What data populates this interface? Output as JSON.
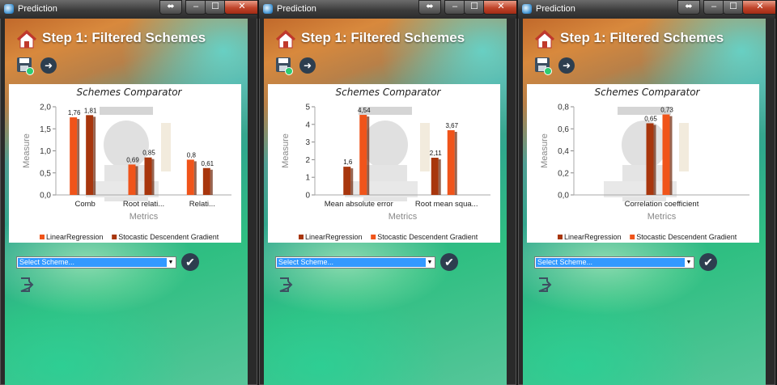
{
  "windows": [
    {
      "title": "Prediction",
      "step_title": "Step 1: Filtered Schemes",
      "combo_value": "Select Scheme...",
      "chart_data": {
        "type": "bar",
        "title": "Schemes Comparator",
        "xlabel": "Metrics",
        "ylabel": "Measure",
        "ylim": [
          0,
          2.0
        ],
        "yticks": [
          "0,0",
          "0,5",
          "1,0",
          "1,5",
          "2,0"
        ],
        "categories": [
          "Comb",
          "Root relati...",
          "Relati..."
        ],
        "series": [
          {
            "name": "LinearRegression",
            "values": [
              1.76,
              0.69,
              0.8
            ],
            "labels": [
              "1,76",
              "0,69",
              "0,8"
            ],
            "color": "#f0541a"
          },
          {
            "name": "Stocastic Descendent Gradient",
            "values": [
              1.81,
              0.85,
              0.61
            ],
            "labels": [
              "1,81",
              "0,85",
              "0,61"
            ],
            "color": "#a8360d"
          }
        ],
        "legend": "bottom"
      }
    },
    {
      "title": "Prediction",
      "step_title": "Step 1: Filtered Schemes",
      "combo_value": "Select Scheme...",
      "chart_data": {
        "type": "bar",
        "title": "Schemes Comparator",
        "xlabel": "Metrics",
        "ylabel": "Measure",
        "ylim": [
          0,
          5
        ],
        "yticks": [
          "0",
          "1",
          "2",
          "3",
          "4",
          "5"
        ],
        "categories": [
          "Mean absolute error",
          "Root mean squa..."
        ],
        "series": [
          {
            "name": "LinearRegression",
            "values": [
              1.6,
              2.11
            ],
            "labels": [
              "1,6",
              "2,11"
            ],
            "color": "#a8360d"
          },
          {
            "name": "Stocastic Descendent Gradient",
            "values": [
              4.54,
              3.67
            ],
            "labels": [
              "4,54",
              "3,67"
            ],
            "color": "#f0541a"
          }
        ],
        "legend": "bottom"
      }
    },
    {
      "title": "Prediction",
      "step_title": "Step 1: Filtered Schemes",
      "combo_value": "Select Scheme...",
      "chart_data": {
        "type": "bar",
        "title": "Schemes Comparator",
        "xlabel": "Metrics",
        "ylabel": "Measure",
        "ylim": [
          0,
          0.8
        ],
        "yticks": [
          "0,0",
          "0,2",
          "0,4",
          "0,6",
          "0,8"
        ],
        "categories": [
          "Correlation coefficient"
        ],
        "series": [
          {
            "name": "LinearRegression",
            "values": [
              0.65
            ],
            "labels": [
              "0,65"
            ],
            "color": "#a8360d"
          },
          {
            "name": "Stocastic Descendent Gradient",
            "values": [
              0.73
            ],
            "labels": [
              "0,73"
            ],
            "color": "#f0541a"
          }
        ],
        "legend": "bottom"
      }
    }
  ],
  "titlebar_buttons": {
    "swap": "⬌",
    "minimize": "–",
    "maximize": "☐",
    "close": "✕"
  },
  "icons": {
    "home": "home-icon",
    "save": "save-icon",
    "next": "arrow-right-icon",
    "confirm": "checkmark-icon",
    "exit": "exit-icon"
  },
  "glyphs": {
    "next": "➜",
    "confirm": "✔",
    "dropdown": "▼"
  }
}
